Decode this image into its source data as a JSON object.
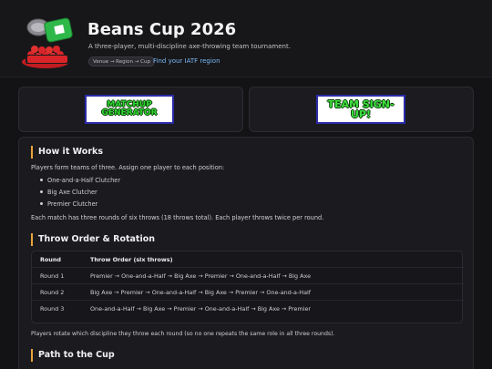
{
  "header": {
    "title": "Beans Cup 2026",
    "tagline": "A three-player, multi-discipline axe-throwing team tournament.",
    "breadcrumb": "Venue → Region → Cup",
    "find_link": "Find your IATF region"
  },
  "cards": {
    "matchup_label": "MATCHUP GENERATOR",
    "signup_label": "TEAM SIGN-UP!"
  },
  "how_it_works": {
    "heading": "How it Works",
    "intro": "Players form teams of three. Assign one player to each position:",
    "positions": [
      "One-and-a-Half Clutcher",
      "Big Axe Clutcher",
      "Premier Clutcher"
    ],
    "summary": "Each match has three rounds of six throws (18 throws total). Each player throws twice per round."
  },
  "throw_order": {
    "heading": "Throw Order & Rotation",
    "columns": [
      "Round",
      "Throw Order (six throws)"
    ],
    "rows": [
      {
        "round": "Round 1",
        "order": "Premier → One-and-a-Half → Big Axe → Premier → One-and-a-Half → Big Axe"
      },
      {
        "round": "Round 2",
        "order": "Big Axe → Premier → One-and-a-Half → Big Axe → Premier → One-and-a-Half"
      },
      {
        "round": "Round 3",
        "order": "One-and-a-Half → Big Axe → Premier → One-and-a-Half → Big Axe → Premier"
      }
    ],
    "note": "Players rotate which discipline they throw each round (so no one repeats the same role in all three rounds)."
  },
  "path_to_cup": {
    "heading": "Path to the Cup"
  },
  "colors": {
    "accent": "#e8a43a",
    "link": "#7ab8f5",
    "logo_green": "#2fb84a",
    "logo_red": "#d9252a"
  }
}
